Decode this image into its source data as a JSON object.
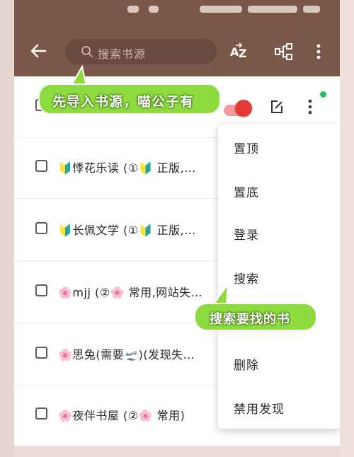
{
  "toolbar": {
    "search_placeholder": "搜索书源",
    "sort_icon": "sort-az-icon",
    "group_icon": "group-icon",
    "more_icon": "more-vertical-icon",
    "back_icon": "arrow-back-icon"
  },
  "list": {
    "items": [
      {
        "label": "🔰悸花乐读 (①🔰  正版,…"
      },
      {
        "label": "🔰长佩文学 (①🔰  正版,…"
      },
      {
        "label": "🌸mjj (②🌸  常用,网站失…"
      },
      {
        "label": "🌸思兔(需要🛫)(发现失…"
      },
      {
        "label": "🌸夜伴书屋 (②🌸  常用)"
      }
    ]
  },
  "menu": {
    "items": [
      "置顶",
      "置底",
      "登录",
      "搜索",
      "删除",
      "禁用发现"
    ]
  },
  "annotations": {
    "import_tip": "先导入书源，喵公子有",
    "search_tip": "搜索要找的书"
  },
  "colors": {
    "appbar": "#7a5749",
    "toggle_on": "#e53935",
    "bubble": "#8ddb3e",
    "status_dot": "#22c55e"
  }
}
